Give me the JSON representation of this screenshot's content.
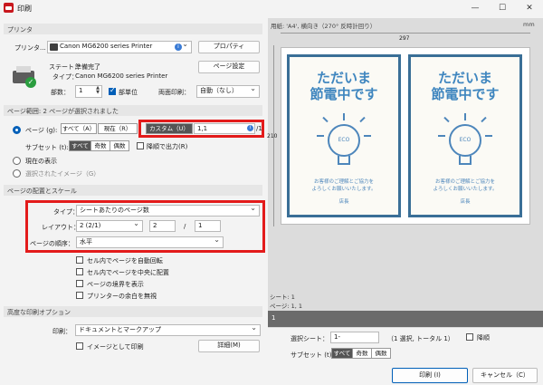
{
  "window": {
    "title": "印刷",
    "minimize": "—",
    "maximize": "☐",
    "close": "✕"
  },
  "printer": {
    "section": "プリンタ",
    "label": "プリンタ...",
    "name": "Canon MG6200 series Printer",
    "properties_button": "プロパティ",
    "status_label": "ステート：",
    "status_value": "準備完了",
    "type_label": "タイプ：",
    "type_value": "Canon MG6200 series Printer",
    "page_setup_button": "ページ設定",
    "copies_label": "部数：",
    "copies_value": "1",
    "collate_label": "部単位",
    "duplex_label": "両面印刷：",
    "duplex_value": "自動（なし）"
  },
  "page_range": {
    "section": "ページ範囲: 2 ページが選択されました",
    "pages_label": "ページ (g):",
    "all_label": "すべて（A）",
    "current_label": "現在（R）",
    "custom_label": "カスタム（U）",
    "custom_value": "1,1",
    "total_suffix": "/1",
    "subset_label": "サブセット (t):",
    "subset_all": "すべて",
    "subset_odd": "奇数",
    "subset_even": "偶数",
    "reverse_label": "降順で出力(R)",
    "current_view_label": "現在の表示",
    "selected_image_label": "選択されたイメージ（G）"
  },
  "layout": {
    "section": "ページの配置とスケール",
    "type_label": "タイプ：",
    "type_value": "シートあたりのページ数",
    "layout_label": "レイアウト：",
    "layout_value": "2 (2/1)",
    "layout_cols": "2",
    "layout_sep": "/",
    "layout_rows": "1",
    "order_label": "ページの順序：",
    "order_value": "水平",
    "auto_rotate_label": "セル内でページを自動回転",
    "center_label": "セル内でページを中央に配置",
    "border_label": "ページの境界を表示",
    "ignore_margin_label": "プリンターの余白を無視"
  },
  "advanced": {
    "section": "高度な印刷オプション",
    "print_label": "印刷：",
    "print_value": "ドキュメントとマークアップ",
    "as_image_label": "イメージとして印刷",
    "details_button": "詳細(M)"
  },
  "preview": {
    "header": "用紙: 'A4', 横向き（270° 反時計回り）",
    "units": "mm",
    "width_value": "297",
    "height_value": "210",
    "poster_title_line1": "ただいま",
    "poster_title_line2": "節電中です",
    "bulb_text": "ECO",
    "poster_msg_line1": "お客様のご理解とご協力を",
    "poster_msg_line2": "よろしくお願いいたします。",
    "poster_sign": "店長",
    "sheet_info": "シート: 1",
    "page_info": "ページ: 1, 1",
    "scroll_number": "1",
    "select_sheet_label": "選択シート：",
    "select_sheet_value": "1-",
    "selection_info": "（1 選択, トータル 1）",
    "descending_label": "降順",
    "subset_label": "サブセット (t):",
    "subset_all": "すべて",
    "subset_odd": "奇数",
    "subset_even": "偶数"
  },
  "footer": {
    "print_button": "印刷 (I)",
    "cancel_button": "キャンセル（C）"
  },
  "colors": {
    "accent": "#005fb8",
    "highlight": "#e31b1b",
    "poster_blue": "#3f86bf"
  }
}
